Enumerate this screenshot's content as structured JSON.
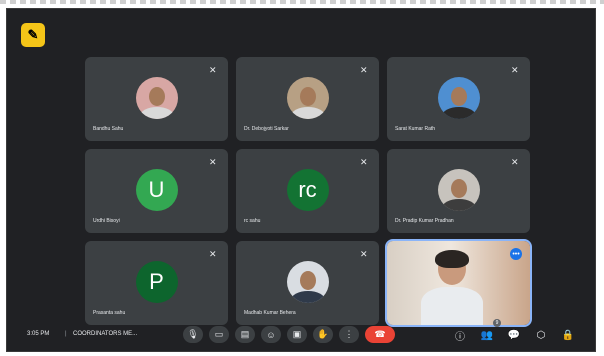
{
  "app": {
    "badge_icon": "meet-logo-icon"
  },
  "tiles": [
    {
      "name": "Bandhu Sahu",
      "type": "photo"
    },
    {
      "name": "Dr. Debojyoti Sarkar",
      "type": "photo"
    },
    {
      "name": "Sarat Kumar Rath",
      "type": "photo"
    },
    {
      "name": "Urdhi Bisoyi",
      "type": "initial",
      "initial": "U",
      "color": "#33a852"
    },
    {
      "name": "rc sahu",
      "type": "initial",
      "initial": "rc",
      "color": "#137333"
    },
    {
      "name": "Dr. Pradip Kumar Pradhan",
      "type": "photo"
    },
    {
      "name": "Prasanta sahu",
      "type": "initial",
      "initial": "P",
      "color": "#0d652d"
    },
    {
      "name": "Madhab Kumar Behera",
      "type": "photo"
    }
  ],
  "self_view": {
    "speaking_icon": "audio-level-icon"
  },
  "bottombar": {
    "time": "3:05 PM",
    "separator": "|",
    "meeting_name": "COORDINATORS ME...",
    "controls": [
      "mic-icon",
      "camera-icon",
      "captions-icon",
      "emoji-icon",
      "present-icon",
      "raise-hand-icon",
      "more-icon",
      "end-call-icon"
    ],
    "right_controls": [
      "info-icon",
      "people-icon",
      "chat-icon",
      "activities-icon",
      "lock-icon"
    ],
    "people_count": "9"
  },
  "colors": {
    "background": "#202124",
    "tile": "#3c4043",
    "end_call": "#ea4335"
  }
}
